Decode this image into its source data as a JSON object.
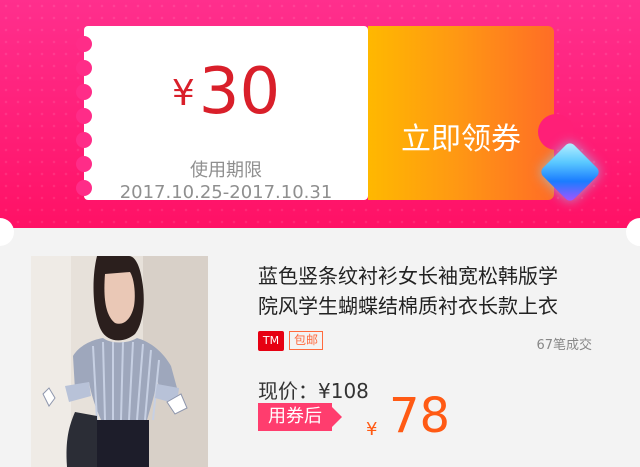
{
  "coupon": {
    "currency": "¥",
    "amount": "30",
    "validity_label": "使用期限",
    "validity_dates": "2017.10.25-2017.10.31",
    "claim_button": "立即领券"
  },
  "product": {
    "title_line1": "蓝色竖条纹衬衫女长袖宽松韩版学",
    "title_line2": "院风学生蝴蝶结棉质衬衣长款上衣",
    "shop_icon_text": "TM",
    "free_shipping": "包邮",
    "sales_count": "67笔成交",
    "current_price": "现价：¥108",
    "after_coupon_label": "用券后",
    "final_currency": "¥",
    "final_price": "78"
  },
  "colors": {
    "background_band": "#ff2686",
    "button_gradient_start": "#ffb800",
    "button_gradient_end": "#ff6d26",
    "price_red": "#d91f2a",
    "final_price_orange": "#ff5a14",
    "badge_pink": "#ff3d6e"
  }
}
